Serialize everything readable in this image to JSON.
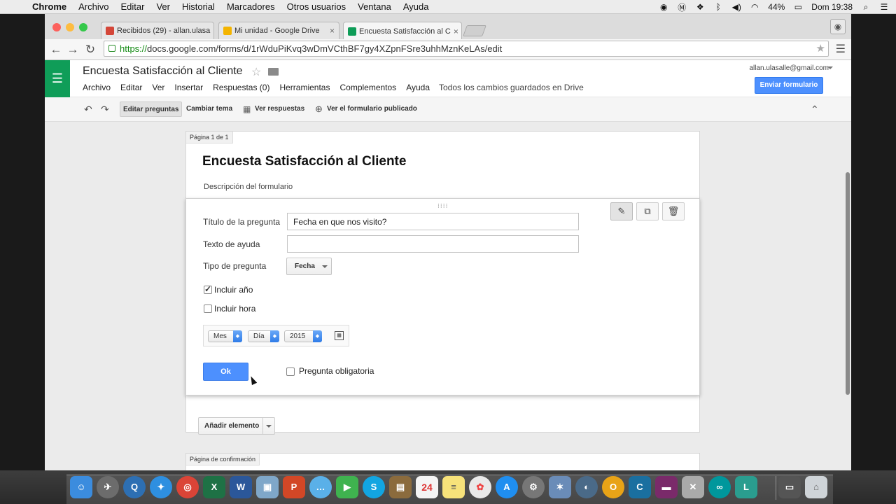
{
  "mac_menubar": {
    "app": "Chrome",
    "items": [
      "Archivo",
      "Editar",
      "Ver",
      "Historial",
      "Marcadores",
      "Otros usuarios",
      "Ventana",
      "Ayuda"
    ],
    "battery": "44%",
    "clock": "Dom 19:38"
  },
  "browser": {
    "tabs": [
      {
        "label": "Recibidos (29) - allan.ulasa",
        "favicon_color": "#d44638"
      },
      {
        "label": "Mi unidad - Google Drive",
        "favicon_color": "#f4b400"
      },
      {
        "label": "Encuesta Satisfacción al C",
        "favicon_color": "#0f9d58"
      }
    ],
    "url_scheme": "https://",
    "url_rest": "docs.google.com/forms/d/1rWduPiKvq3wDmVCthBF7gy4XZpnFSre3uhhMznKeLAs/edit"
  },
  "forms_header": {
    "title": "Encuesta Satisfacción al Cliente",
    "menu": [
      "Archivo",
      "Editar",
      "Ver",
      "Insertar",
      "Respuestas (0)",
      "Herramientas",
      "Complementos",
      "Ayuda"
    ],
    "save_status": "Todos los cambios guardados en Drive",
    "account": "allan.ulasalle@gmail.com",
    "send_button": "Enviar formulario"
  },
  "edit_bar": {
    "edit_questions": "Editar preguntas",
    "change_theme": "Cambiar tema",
    "view_responses": "Ver respuestas",
    "view_published": "Ver el formulario publicado"
  },
  "form": {
    "page_label": "Página 1 de 1",
    "title": "Encuesta Satisfacción al Cliente",
    "description_placeholder": "Descripción del formulario",
    "question": {
      "title_label": "Título de la pregunta",
      "title_value": "Fecha en que nos visito?",
      "help_label": "Texto de ayuda",
      "help_value": "",
      "type_label": "Tipo de pregunta",
      "type_value": "Fecha",
      "include_year": "Incluir año",
      "include_year_checked": true,
      "include_time": "Incluir hora",
      "include_time_checked": false,
      "preview": {
        "month": "Mes",
        "day": "Día",
        "year": "2015"
      },
      "ok_button": "Ok",
      "required_label": "Pregunta obligatoria",
      "required_checked": false
    },
    "add_item": "Añadir elemento",
    "confirmation_label": "Página de confirmación"
  },
  "colors": {
    "forms_green": "#0f9d58",
    "primary_blue": "#4d90fe"
  }
}
